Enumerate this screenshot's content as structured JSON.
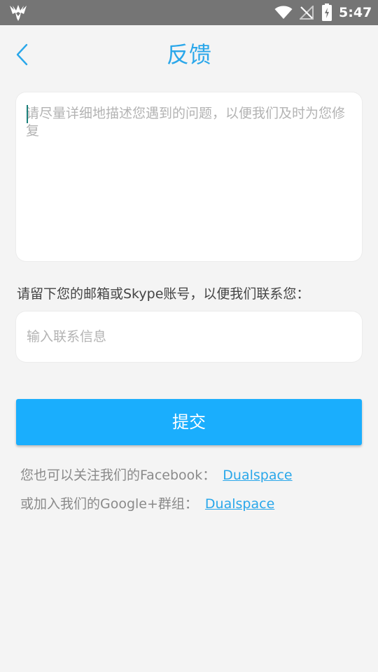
{
  "status_bar": {
    "time": "5:47",
    "icons": [
      "app-logo-icon",
      "wifi-icon",
      "no-signal-icon",
      "battery-charging-icon"
    ]
  },
  "header": {
    "back_icon": "chevron-left-icon",
    "title": "反馈"
  },
  "feedback": {
    "placeholder": "请尽量详细地描述您遇到的问题，以便我们及时为您修复",
    "value": ""
  },
  "contact": {
    "label": "请留下您的邮箱或Skype账号，以便我们联系您：",
    "placeholder": "输入联系信息",
    "value": ""
  },
  "submit": {
    "label": "提交"
  },
  "social": {
    "facebook_text": "您也可以关注我们的Facebook：",
    "facebook_link": "Dualspace",
    "google_text": "或加入我们的Google+群组：",
    "google_link": "Dualspace"
  },
  "colors": {
    "accent": "#2aa7ea",
    "button": "#1aaefd",
    "status_bar": "#757575",
    "background": "#f4f4f4"
  }
}
